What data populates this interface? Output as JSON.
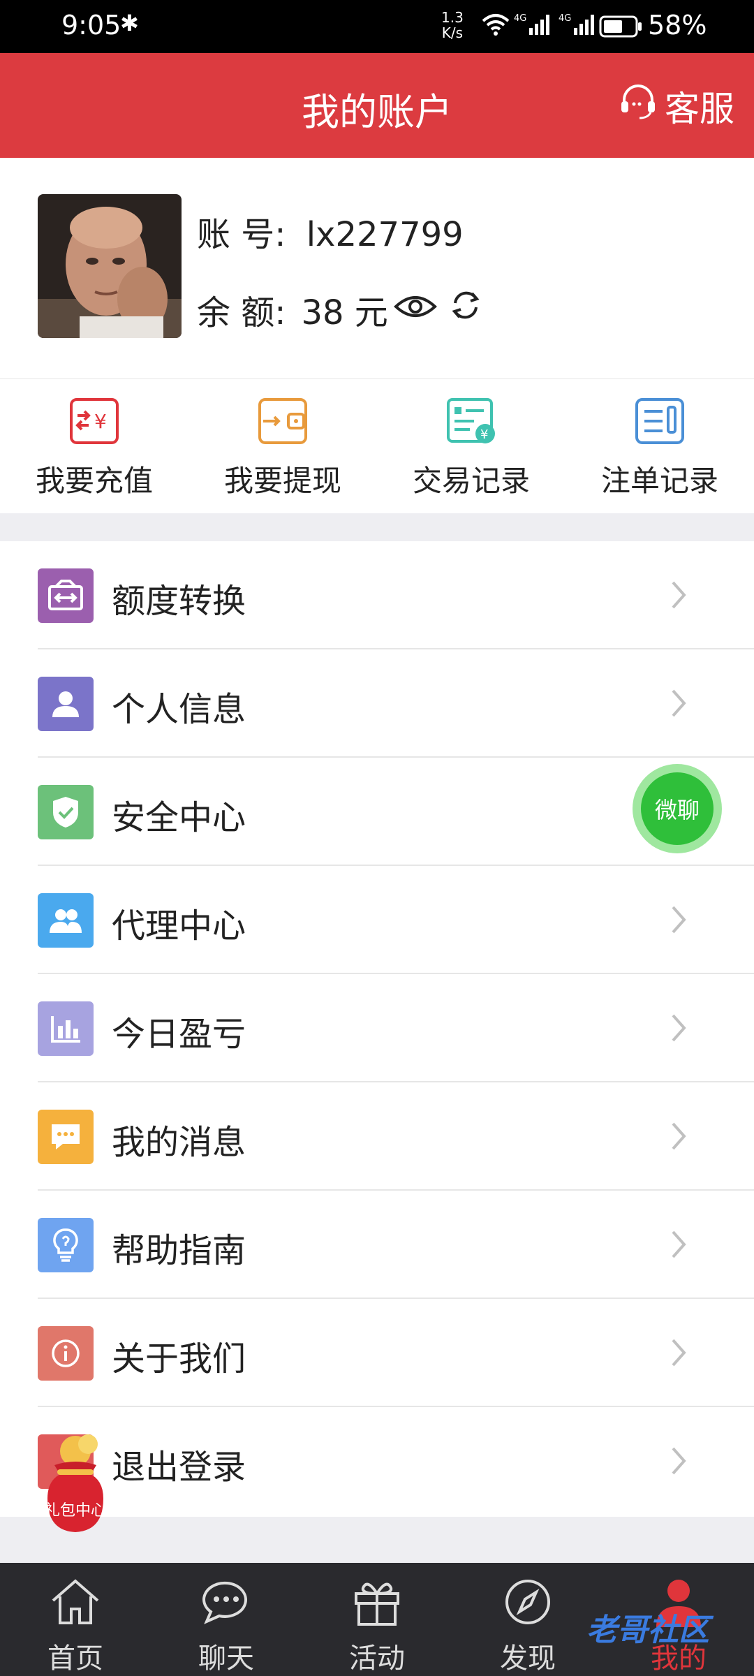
{
  "status_bar": {
    "time": "9:05",
    "speed": "1.3\nK/s",
    "net1": "4G",
    "net2": "4G",
    "battery": "58%"
  },
  "header": {
    "title": "我的账户",
    "service": "客服"
  },
  "account": {
    "account_label": "账 号:",
    "account_value": "lx227799",
    "balance_label": "余 额:",
    "balance_value": "38 元"
  },
  "actions": [
    {
      "label": "我要充值",
      "icon": "recharge-icon",
      "color": "#e0353b"
    },
    {
      "label": "我要提现",
      "icon": "withdraw-icon",
      "color": "#e89a3c"
    },
    {
      "label": "交易记录",
      "icon": "transaction-record-icon",
      "color": "#3fc2b0"
    },
    {
      "label": "注单记录",
      "icon": "bet-record-icon",
      "color": "#4a8fd6"
    }
  ],
  "menu": [
    {
      "label": "额度转换",
      "icon": "transfer-icon",
      "color": "#9b5fae"
    },
    {
      "label": "个人信息",
      "icon": "person-icon",
      "color": "#7b74c9"
    },
    {
      "label": "安全中心",
      "icon": "shield-icon",
      "color": "#6cc17a"
    },
    {
      "label": "代理中心",
      "icon": "agents-icon",
      "color": "#4aa9ee"
    },
    {
      "label": "今日盈亏",
      "icon": "bar-chart-icon",
      "color": "#a7a3e0"
    },
    {
      "label": "我的消息",
      "icon": "message-icon",
      "color": "#f5b13d"
    },
    {
      "label": "帮助指南",
      "icon": "lightbulb-icon",
      "color": "#6fa4f0"
    },
    {
      "label": "关于我们",
      "icon": "info-icon",
      "color": "#e0776a"
    },
    {
      "label": "退出登录",
      "icon": "logout-icon",
      "color": "#e05a5a"
    }
  ],
  "floating": {
    "wechat": "微聊",
    "gift": "礼包中心"
  },
  "tabs": [
    {
      "label": "首页",
      "icon": "home-icon"
    },
    {
      "label": "聊天",
      "icon": "chat-icon"
    },
    {
      "label": "活动",
      "icon": "gift-icon"
    },
    {
      "label": "发现",
      "icon": "compass-icon"
    },
    {
      "label": "我的",
      "icon": "user-icon",
      "active": true
    }
  ],
  "watermark": "老哥社区"
}
